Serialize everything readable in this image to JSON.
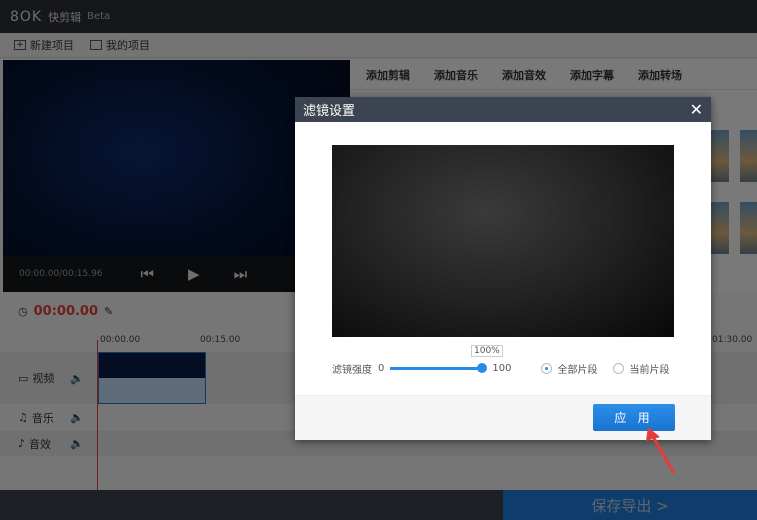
{
  "app": {
    "logo": "8OK",
    "title": "快剪辑",
    "badge": "Beta"
  },
  "toolbar": {
    "new_project": "新建项目",
    "my_projects": "我的项目"
  },
  "player": {
    "time": "00:00.00/00:15.96"
  },
  "right_tabs": [
    "添加剪辑",
    "添加音乐",
    "添加音效",
    "添加字幕",
    "添加转场"
  ],
  "timeline": {
    "current": "00:00.00",
    "ruler": [
      "00:00.00",
      "00:15.00",
      "01:30.00"
    ],
    "tracks": [
      "视频",
      "音乐",
      "音效"
    ]
  },
  "export": {
    "label": "保存导出 >"
  },
  "modal": {
    "title": "滤镜设置",
    "close": "✕",
    "strength_label": "滤镜强度",
    "min": "0",
    "max": "100",
    "value_label": "100%",
    "strength_value": 100,
    "options": [
      "全部片段",
      "当前片段"
    ],
    "selected_option": "全部片段",
    "apply": "应 用"
  },
  "colors": {
    "accent": "#1e7ad6",
    "timecode": "#e03a3a",
    "annotation_arrow": "#e83a3a"
  }
}
